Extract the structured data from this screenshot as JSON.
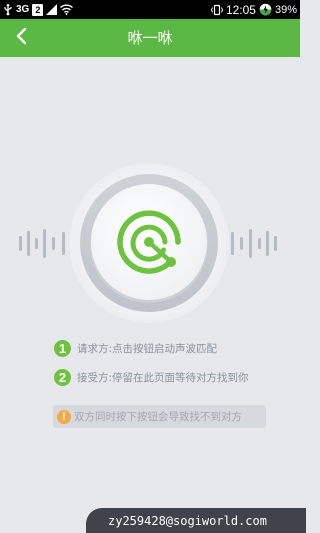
{
  "status_bar": {
    "network": "3G",
    "sim": "2",
    "time": "12:05",
    "battery": "39%",
    "icons": [
      "usb-icon",
      "signal-icon",
      "wifi-icon",
      "vibrate-icon",
      "battery-icon"
    ]
  },
  "header": {
    "title": "咻一咻",
    "back_icon": "chevron-left-icon",
    "background": "#5cb845"
  },
  "main": {
    "radar_icon": "radar-icon",
    "accent": "#6ec23f",
    "instructions": [
      {
        "number": "1",
        "text": "请求方:点击按钮启动声波匹配"
      },
      {
        "number": "2",
        "text": "接受方:停留在此页面等待对方找到你"
      }
    ],
    "warning": {
      "icon": "!",
      "text": "双方同时按下按钮会导致找不到对方",
      "color": "#f4a947"
    }
  },
  "watermark": "zy259428@sogiworld.com"
}
